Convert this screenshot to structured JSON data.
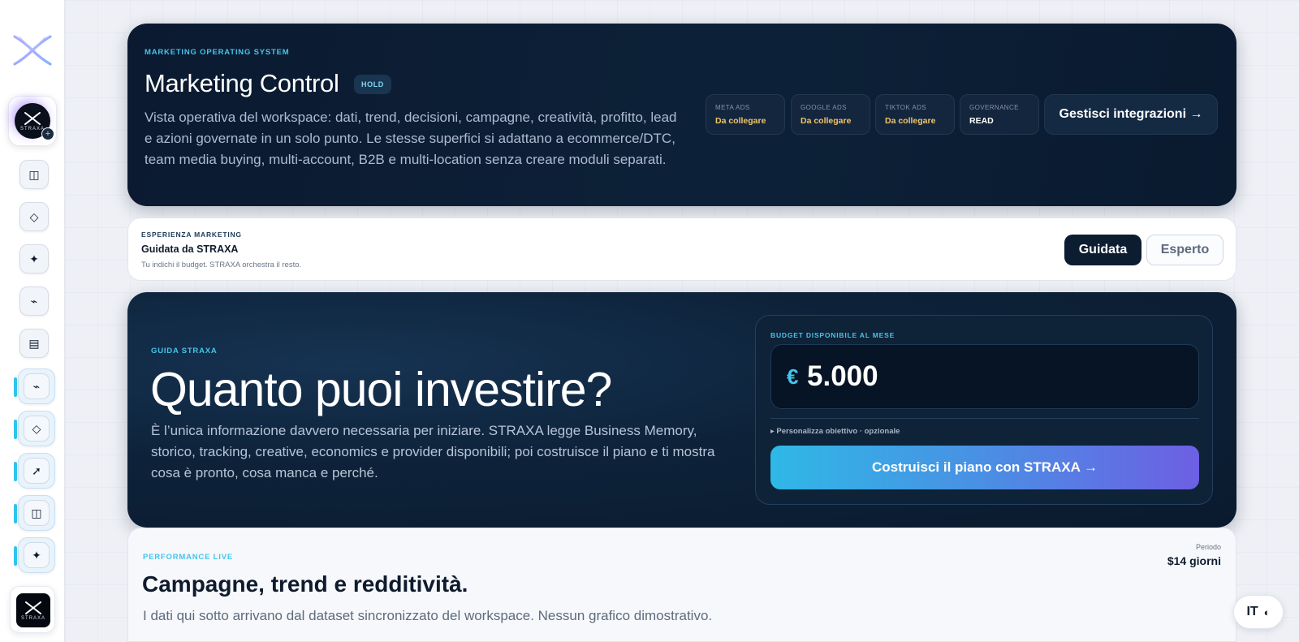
{
  "sidebar": {
    "logo_icon": "straxa-x-logo-icon",
    "workspace_label": "STRAXA",
    "workspace_add_icon": "+",
    "items": [
      {
        "icon": "panels-icon",
        "glyph": "◫",
        "active": false
      },
      {
        "icon": "diamond-icon",
        "glyph": "◇",
        "active": false
      },
      {
        "icon": "sparkle-icon",
        "glyph": "✦",
        "active": false
      },
      {
        "icon": "pulse-icon",
        "glyph": "⌁",
        "active": false
      },
      {
        "icon": "document-icon",
        "glyph": "▤",
        "active": false
      },
      {
        "icon": "pulse-icon",
        "glyph": "⌁",
        "active": true
      },
      {
        "icon": "diamond-icon",
        "glyph": "◇",
        "active": true
      },
      {
        "icon": "arrow-up-right-icon",
        "glyph": "➚",
        "active": true
      },
      {
        "icon": "panels-icon",
        "glyph": "◫",
        "active": true
      },
      {
        "icon": "sparkle-icon",
        "glyph": "✦",
        "active": true
      }
    ],
    "bottom_label": "STRAXA"
  },
  "hero": {
    "eyebrow": "MARKETING OPERATING SYSTEM",
    "title": "Marketing Control",
    "badge": "HOLD",
    "description": "Vista operativa del workspace: dati, trend, decisioni, campagne, creatività, profitto, lead e azioni governate in un solo punto. Le stesse superfici si adattano a ecommerce/DTC, team media buying, multi-account, B2B e multi-location senza creare moduli separati.",
    "integrations": [
      {
        "key": "META ADS",
        "value": "Da collegare"
      },
      {
        "key": "GOOGLE ADS",
        "value": "Da collegare"
      },
      {
        "key": "TIKTOK ADS",
        "value": "Da collegare"
      },
      {
        "key": "GOVERNANCE",
        "value": "READ"
      }
    ],
    "manage_button": "Gestisci integrazioni →"
  },
  "experience": {
    "eyebrow": "ESPERIENZA MARKETING",
    "title": "Guidata da STRAXA",
    "subtitle": "Tu indichi il budget. STRAXA orchestra il resto.",
    "modes": [
      "Guidata",
      "Esperto"
    ],
    "selected_mode": "Guidata"
  },
  "guide": {
    "eyebrow": "GUIDA STRAXA",
    "title": "Quanto puoi investire?",
    "description": "È l’unica informazione davvero necessaria per iniziare. STRAXA legge Business Memory, storico, tracking, creative, economics e provider disponibili; poi costruisce il piano e ti mostra cosa è pronto, cosa manca e perché.",
    "budget": {
      "label": "BUDGET DISPONIBILE AL MESE",
      "currency": "€",
      "value": "5.000",
      "customize": "▸ Personalizza obiettivo · opzionale",
      "button": "Costruisci il piano con STRAXA →"
    }
  },
  "performance": {
    "eyebrow": "PERFORMANCE LIVE",
    "title": "Campagne, trend e redditività.",
    "description": "I dati qui sotto arrivano dal dataset sincronizzato del workspace. Nessun grafico dimostrativo.",
    "period_label": "Periodo",
    "period_value": "$14 giorni"
  },
  "language_toggle": {
    "language": "IT",
    "theme_glyph": "◐"
  },
  "colors": {
    "accent_cyan": "#46c4ea",
    "navy": "#0b1a30",
    "warning_amber": "#f2c46a",
    "gradient_end_violet": "#6d5fe3"
  }
}
